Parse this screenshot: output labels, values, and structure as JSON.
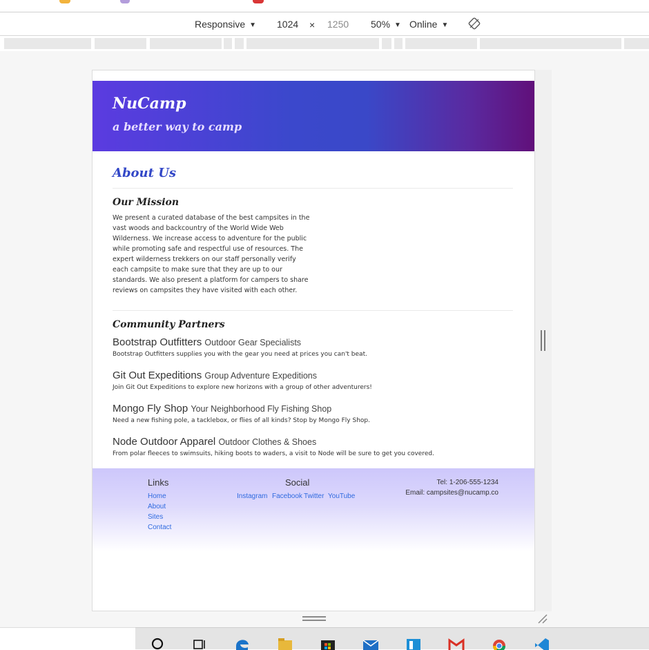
{
  "devtools": {
    "device_mode": "Responsive",
    "width": "1024",
    "times": "×",
    "height": "1250",
    "zoom": "50%",
    "throttle": "Online"
  },
  "site": {
    "brand": "NuCamp",
    "tagline": "a better way to camp",
    "about_title": "About Us",
    "mission_title": "Our Mission",
    "mission_text": "We present a curated database of the best campsites in the vast woods and backcountry of the World Wide Web Wilderness. We increase access to adventure for the public while promoting safe and respectful use of resources. The expert wilderness trekkers on our staff personally verify each campsite to make sure that they are up to our standards. We also present a platform for campers to share reviews on campsites they have visited with each other.",
    "partners_title": "Community Partners",
    "partners": [
      {
        "name": "Bootstrap Outfitters",
        "sub": "Outdoor Gear Specialists",
        "desc": "Bootstrap Outfitters supplies you with the gear you need at prices you can't beat."
      },
      {
        "name": "Git Out Expeditions",
        "sub": "Group Adventure Expeditions",
        "desc": "Join Git Out Expeditions to explore new horizons with a group of other adventurers!"
      },
      {
        "name": "Mongo Fly Shop",
        "sub": "Your Neighborhood Fly Fishing Shop",
        "desc": "Need a new fishing pole, a tacklebox, or flies of all kinds? Stop by Mongo Fly Shop."
      },
      {
        "name": "Node Outdoor Apparel",
        "sub": "Outdoor Clothes & Shoes",
        "desc": "From polar fleeces to swimsuits, hiking boots to waders, a visit to Node will be sure to get you covered."
      }
    ],
    "footer": {
      "links_heading": "Links",
      "links": [
        "Home",
        "About",
        "Sites",
        "Contact"
      ],
      "social_heading": "Social",
      "social": [
        "Instagram",
        "Facebook",
        "Twitter",
        "YouTube"
      ],
      "tel": "Tel: 1-206-555-1234",
      "email": "Email: campsites@nucamp.co"
    }
  },
  "icons": {
    "rotate": "rotate-icon",
    "taskbar": [
      "search-icon",
      "task-view-icon",
      "edge-icon",
      "file-explorer-icon",
      "store-icon",
      "mail-icon",
      "trello-icon",
      "gmail-icon",
      "chrome-icon",
      "vscode-icon"
    ]
  },
  "colors": {
    "jumbotron_start": "#5b3be0",
    "jumbotron_end": "#61107a",
    "heading_blue": "#3247c7",
    "footer_top": "#cdc7fb",
    "link_blue": "#2f6ae0"
  }
}
